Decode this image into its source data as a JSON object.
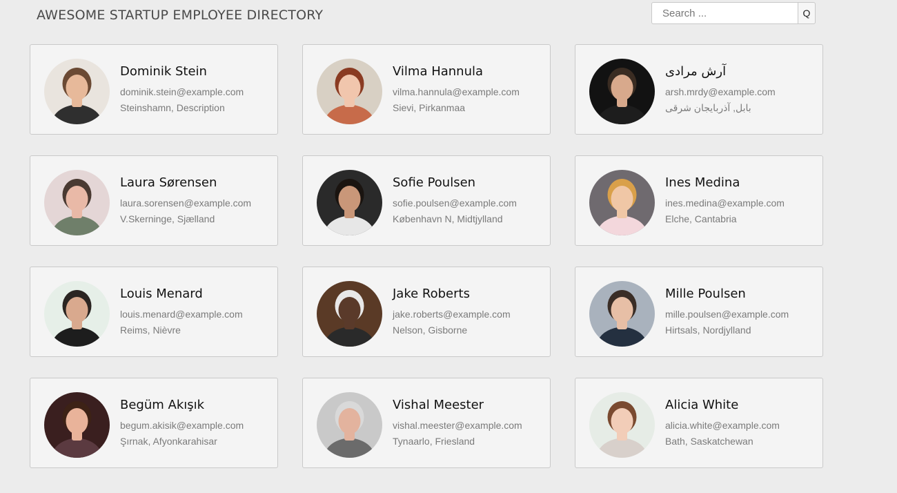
{
  "header": {
    "title": "AWESOME STARTUP EMPLOYEE DIRECTORY",
    "search_placeholder": "Search ...",
    "search_button_label": "Q"
  },
  "employees": [
    {
      "name": "Dominik Stein",
      "email": "dominik.stein@example.com",
      "location": "Steinshamn, Description",
      "avatar": {
        "bg": "#e9e4de",
        "skin": "#e7b99a",
        "hair": "#6b4a34",
        "shirt": "#2f2f2f"
      }
    },
    {
      "name": "Vilma Hannula",
      "email": "vilma.hannula@example.com",
      "location": "Sievi, Pirkanmaa",
      "avatar": {
        "bg": "#d8d0c4",
        "skin": "#f1c6ad",
        "hair": "#8a3b22",
        "shirt": "#c76b4a"
      }
    },
    {
      "name": "آرش مرادی",
      "email": "arsh.mrdy@example.com",
      "location": "بابل, آذربایجان شرقی",
      "avatar": {
        "bg": "#121212",
        "skin": "#d8a98c",
        "hair": "#3a2c22",
        "shirt": "#1d1d1d"
      }
    },
    {
      "name": "Laura Sørensen",
      "email": "laura.sorensen@example.com",
      "location": "V.Skerninge, Sjælland",
      "avatar": {
        "bg": "#e4d6d6",
        "skin": "#e9b9a7",
        "hair": "#4a3a32",
        "shirt": "#6f7f6a"
      }
    },
    {
      "name": "Sofie Poulsen",
      "email": "sofie.poulsen@example.com",
      "location": "København N, Midtjylland",
      "avatar": {
        "bg": "#2a2a2a",
        "skin": "#c99779",
        "hair": "#1a1410",
        "shirt": "#e7e7e7"
      }
    },
    {
      "name": "Ines Medina",
      "email": "ines.medina@example.com",
      "location": "Elche, Cantabria",
      "avatar": {
        "bg": "#6f6a6f",
        "skin": "#f0c7a6",
        "hair": "#d9a04a",
        "shirt": "#f3d7dc"
      }
    },
    {
      "name": "Louis Menard",
      "email": "louis.menard@example.com",
      "location": "Reims, Nièvre",
      "avatar": {
        "bg": "#e6efe8",
        "skin": "#d9a98e",
        "hair": "#2b2522",
        "shirt": "#1d1d1d"
      }
    },
    {
      "name": "Jake Roberts",
      "email": "jake.roberts@example.com",
      "location": "Nelson, Gisborne",
      "avatar": {
        "bg": "#5a3a26",
        "skin": "#5a3a2a",
        "hair": "#e8e8e8",
        "shirt": "#2a2a2a"
      }
    },
    {
      "name": "Mille Poulsen",
      "email": "mille.poulsen@example.com",
      "location": "Hirtsals, Nordjylland",
      "avatar": {
        "bg": "#a9b2bd",
        "skin": "#e7bfa6",
        "hair": "#3a2d26",
        "shirt": "#243040"
      }
    },
    {
      "name": "Begüm Akışık",
      "email": "begum.akisik@example.com",
      "location": "Şırnak, Afyonkarahisar",
      "avatar": {
        "bg": "#3a1f1f",
        "skin": "#e9b39a",
        "hair": "#3d2216",
        "shirt": "#5b3a40"
      }
    },
    {
      "name": "Vishal Meester",
      "email": "vishal.meester@example.com",
      "location": "Tynaarlo, Friesland",
      "avatar": {
        "bg": "#c9c9c9",
        "skin": "#e3b39e",
        "hair": "#d9d9d9",
        "shirt": "#6b6b6b"
      }
    },
    {
      "name": "Alicia White",
      "email": "alicia.white@example.com",
      "location": "Bath, Saskatchewan",
      "avatar": {
        "bg": "#e6ece6",
        "skin": "#f2cdb8",
        "hair": "#7a4a30",
        "shirt": "#d8d0cb"
      }
    }
  ]
}
